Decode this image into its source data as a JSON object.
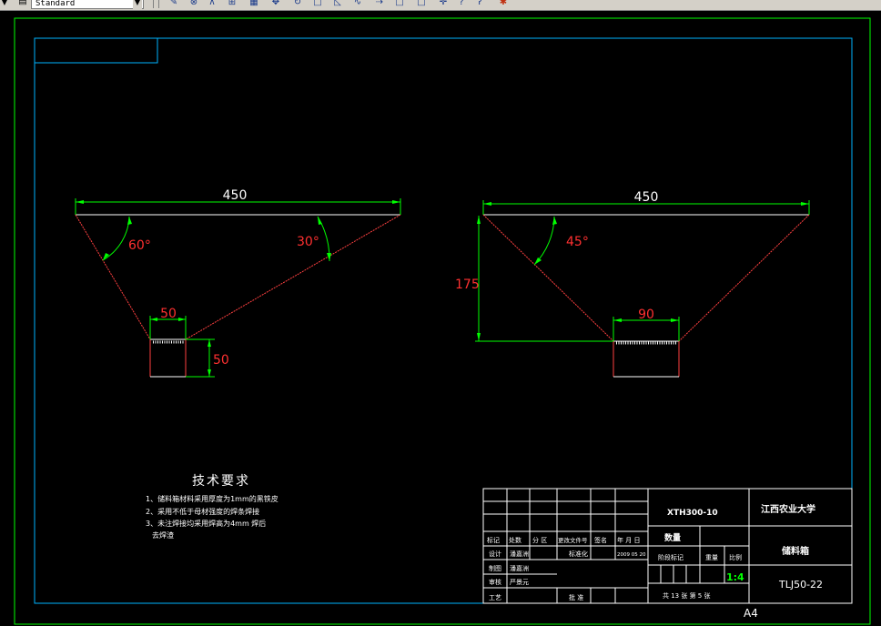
{
  "toolbar": {
    "style_value": "Standard",
    "icons": [
      "pencil-icon",
      "snap-icon",
      "angle-icon",
      "chart-icon",
      "grid-icon",
      "pan-icon",
      "rotate-icon",
      "square-icon",
      "triangle-icon",
      "curve-icon",
      "arrow-icon",
      "box-icon",
      "box2-icon",
      "plus-icon",
      "help-icon",
      "question-icon",
      "paint-icon"
    ]
  },
  "drawing": {
    "left": {
      "top_dim": "450",
      "angle_left": "60°",
      "angle_right": "30°",
      "bottom_dim": "50",
      "side_dim": "50"
    },
    "right": {
      "top_dim": "450",
      "angle": "45°",
      "height_dim": "175",
      "bottom_dim": "90"
    },
    "tech": {
      "title": "技术要求",
      "lines": [
        "1、储料箱材料采用厚度为1mm的黑铁皮",
        "2、采用不低于母材强度的焊条焊接",
        "3、未注焊接均采用焊高为4mm 焊后",
        "去焊渣"
      ]
    },
    "title_block": {
      "drawing_no": "XTH300-10",
      "university": "江西农业大学",
      "part_name": "储料箱",
      "code": "TLJ50-22",
      "scale": "1:4",
      "quantity_label": "数量",
      "stage_label": "阶段标记",
      "weight_label": "重量",
      "ratio_label": "比例",
      "sheets": "共 13 张  第 5 张",
      "paper": "A4",
      "row_labels": [
        "标记",
        "处数",
        "分 区",
        "更改文件号",
        "签名",
        "年 月 日"
      ],
      "design_label": "设计",
      "designer": "潘嘉洲",
      "std_label": "标准化",
      "date": "2009 05 20",
      "draw_label": "制图",
      "drawer": "潘嘉洲",
      "check_label": "审核",
      "checker": "严景元",
      "process_label": "工艺",
      "approve_label": "批 准"
    }
  }
}
